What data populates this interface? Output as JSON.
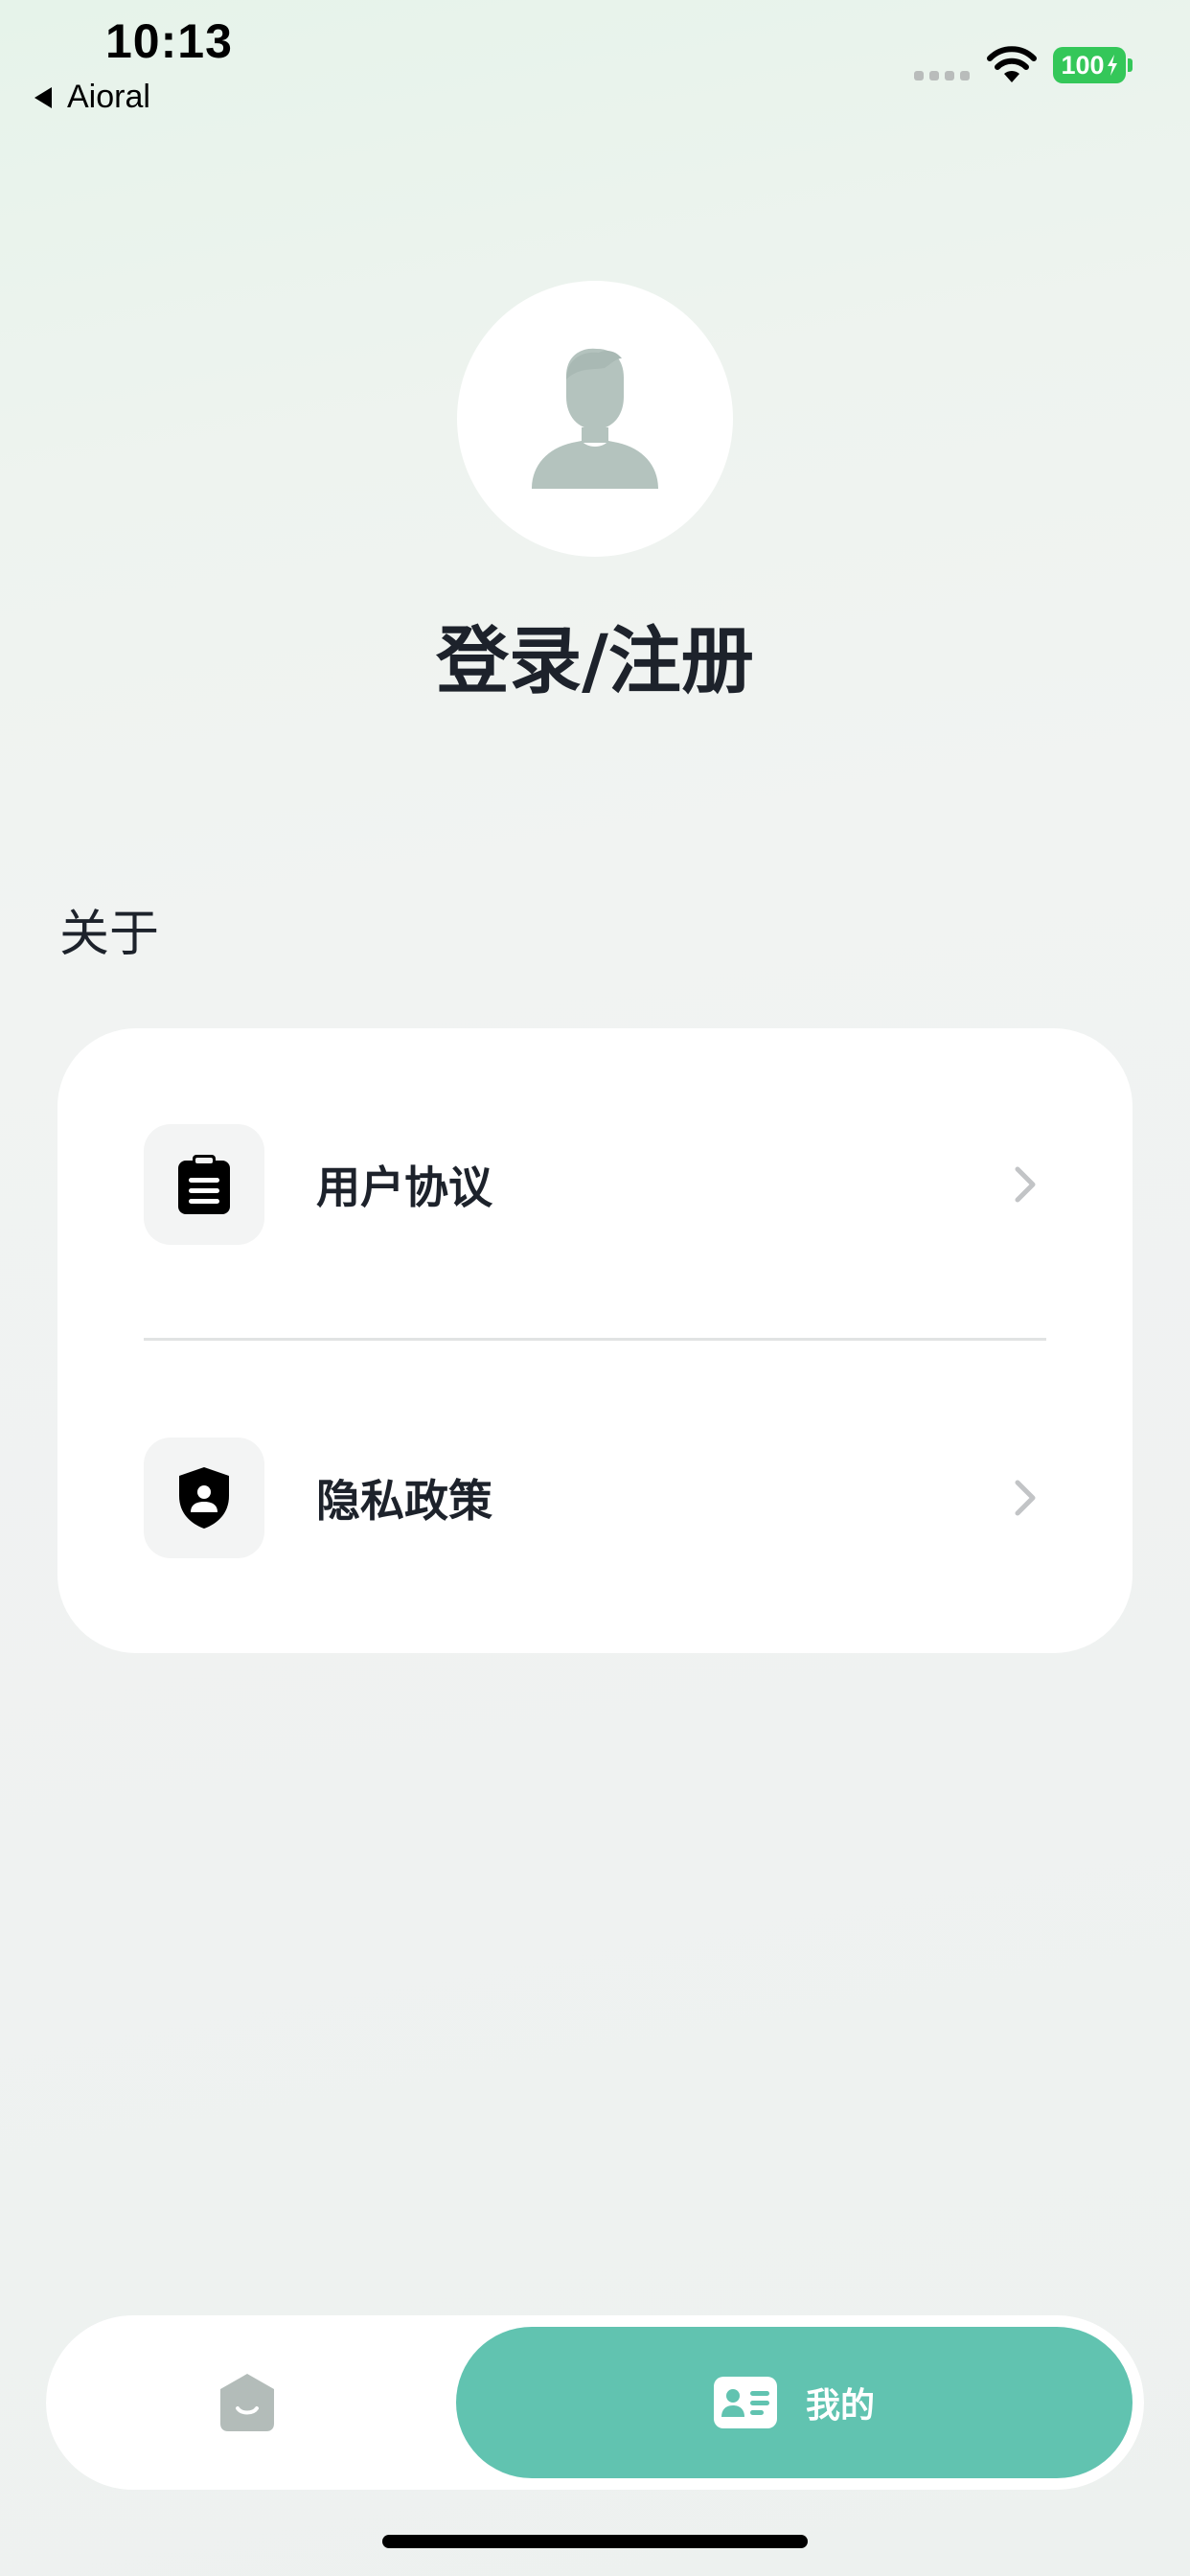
{
  "status_bar": {
    "time": "10:13",
    "back_app": "Aioral",
    "battery": "100"
  },
  "profile": {
    "login_title": "登录/注册"
  },
  "about": {
    "section_label": "关于",
    "items": [
      {
        "label": "用户协议",
        "icon": "clipboard-icon"
      },
      {
        "label": "隐私政策",
        "icon": "shield-user-icon"
      }
    ]
  },
  "tabbar": {
    "tabs": [
      {
        "label": "",
        "icon": "home-icon",
        "active": false
      },
      {
        "label": "我的",
        "icon": "id-card-icon",
        "active": true
      }
    ]
  },
  "colors": {
    "accent": "#61c3b0",
    "battery": "#34c759",
    "avatar_silhouette": "#b4c3be"
  }
}
